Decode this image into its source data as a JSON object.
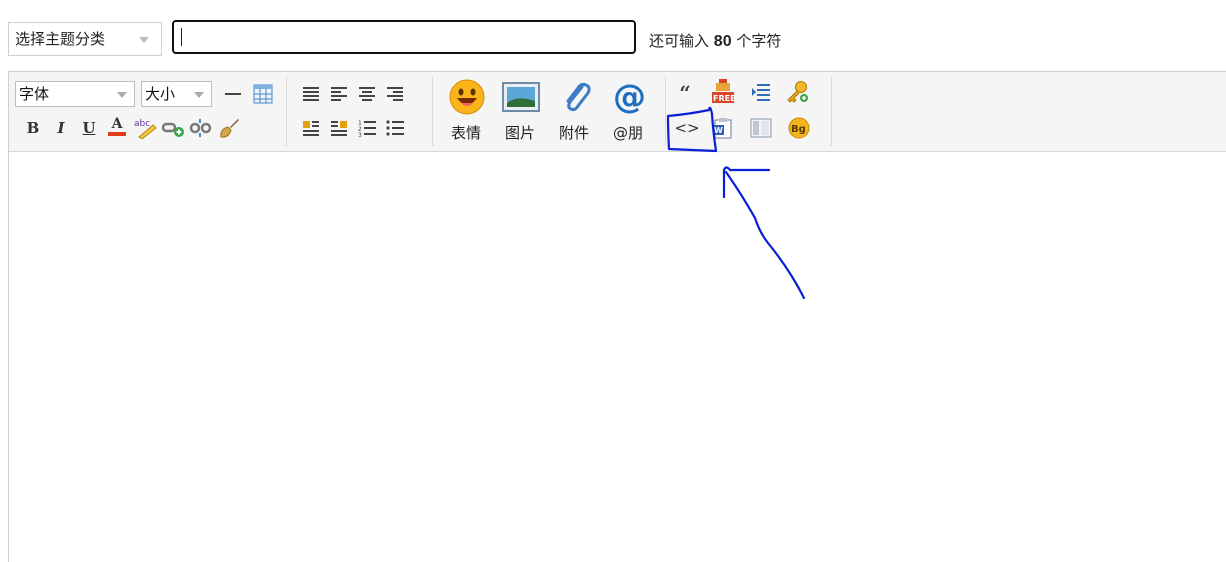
{
  "header": {
    "type_select_label": "选择主题分类",
    "title_value": "",
    "char_hint_prefix": "还可输入",
    "char_hint_count": "80",
    "char_hint_suffix": "个字符"
  },
  "toolbar": {
    "font_label": "字体",
    "size_label": "大小",
    "bold": "B",
    "italic": "I",
    "underline": "U",
    "font_color": "A",
    "big_buttons": [
      {
        "label": "表情",
        "icon": "smiley-icon"
      },
      {
        "label": "图片",
        "icon": "image-icon"
      },
      {
        "label": "附件",
        "icon": "paperclip-icon"
      },
      {
        "label": "@朋",
        "icon": "at-icon"
      }
    ],
    "quote_glyph": "“",
    "code_glyph": "<>",
    "bg_badge": "Bg",
    "free_badge": "FREE"
  },
  "annotation": {
    "box_color": "#0a1fd6",
    "arrow_color": "#0a1fd6"
  }
}
